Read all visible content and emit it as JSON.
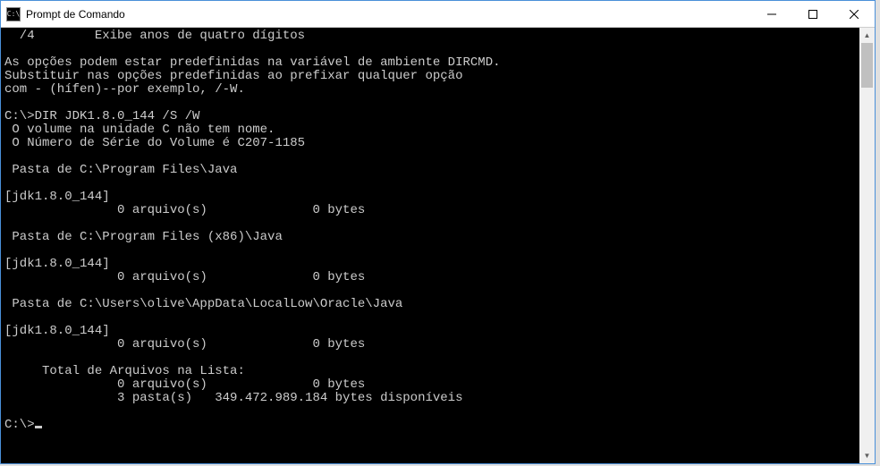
{
  "window": {
    "title": "Prompt de Comando",
    "icon_label": "C:\\"
  },
  "console": {
    "lines": [
      "  /4        Exibe anos de quatro dígitos",
      "",
      "As opções podem estar predefinidas na variável de ambiente DIRCMD.",
      "Substituir nas opções predefinidas ao prefixar qualquer opção",
      "com - (hífen)--por exemplo, /-W.",
      "",
      "C:\\>DIR JDK1.8.0_144 /S /W",
      " O volume na unidade C não tem nome.",
      " O Número de Série do Volume é C207-1185",
      "",
      " Pasta de C:\\Program Files\\Java",
      "",
      "[jdk1.8.0_144]",
      "               0 arquivo(s)              0 bytes",
      "",
      " Pasta de C:\\Program Files (x86)\\Java",
      "",
      "[jdk1.8.0_144]",
      "               0 arquivo(s)              0 bytes",
      "",
      " Pasta de C:\\Users\\olive\\AppData\\LocalLow\\Oracle\\Java",
      "",
      "[jdk1.8.0_144]",
      "               0 arquivo(s)              0 bytes",
      "",
      "     Total de Arquivos na Lista:",
      "               0 arquivo(s)              0 bytes",
      "               3 pasta(s)   349.472.989.184 bytes disponíveis",
      "",
      "C:\\>"
    ],
    "prompt": "C:\\>"
  }
}
